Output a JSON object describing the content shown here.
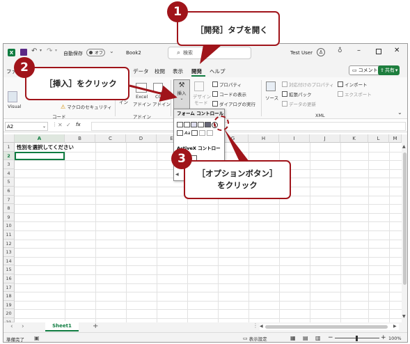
{
  "titlebar": {
    "autosave_label": "自動保存",
    "autosave_state": "オフ",
    "doc_name": "Book2",
    "search_placeholder": "検索",
    "user_name": "Test User"
  },
  "tabs": [
    "ファ",
    "データ",
    "校閲",
    "表示",
    "開発",
    "ヘルプ"
  ],
  "active_tab": "開発",
  "comment_button": "コメント",
  "share_button": "共有",
  "ribbon": {
    "code_group": {
      "visual_label": "Visual",
      "macro_security": "マクロのセキュリティ",
      "group_label": "コード"
    },
    "addin_group": {
      "addin_partial": "イン",
      "excel_addin_line1": "Excel",
      "excel_addin_line2": "アドイン",
      "com_addin_line1": "CO",
      "com_addin_line2": "アドイン",
      "group_label": "アドイン"
    },
    "controls_group": {
      "insert_label": "挿入",
      "design_line1": "デザイン",
      "design_line2": "モード",
      "properties": "プロパティ",
      "view_code": "コードの表示",
      "run_dialog": "ダイアログの実行"
    },
    "xml_group": {
      "source": "ソース",
      "map_properties": "対応付けのプロパティ",
      "expansion_pack": "拡張パック",
      "refresh_data": "データの更新",
      "import": "インポート",
      "export": "エクスポート",
      "group_label": "XML"
    }
  },
  "formula_bar": {
    "name_box": "A2",
    "fx": "fx",
    "value": ""
  },
  "insert_dropdown": {
    "form_controls_label": "フォーム コントロール",
    "activex_label": "ActiveX コントロール"
  },
  "columns": [
    "A",
    "B",
    "C",
    "D",
    "E",
    "F",
    "G",
    "H",
    "I",
    "J",
    "K",
    "L",
    "M"
  ],
  "rows": [
    "1",
    "2",
    "3",
    "4",
    "5",
    "6",
    "7",
    "8",
    "9",
    "10",
    "11",
    "12",
    "13",
    "14",
    "15",
    "16",
    "17",
    "18",
    "19",
    "20",
    "21"
  ],
  "cell_a1": "性別を選択してください",
  "sheet_tab": "Sheet1",
  "add_sheet": "+",
  "status": {
    "ready": "準備完了",
    "display_settings": "表示設定",
    "zoom": "100%"
  },
  "callouts": {
    "c1": {
      "num": "1",
      "text": "［開発］タブを開く"
    },
    "c2": {
      "num": "2",
      "text": "［挿入］をクリック"
    },
    "c3": {
      "num": "3",
      "text_line1": "［オプションボタン］",
      "text_line2": "をクリック"
    }
  },
  "colors": {
    "accent": "#a0141a",
    "excel_green": "#107c41",
    "share_green": "#1e7e3e"
  }
}
